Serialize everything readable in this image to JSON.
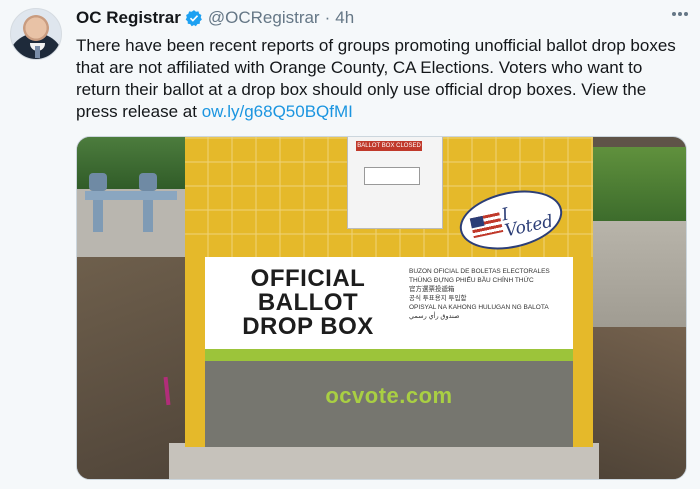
{
  "tweet": {
    "author_name": "OC Registrar",
    "handle": "@OCRegistrar",
    "separator": "·",
    "time": "4h",
    "body_text": "There have been recent reports of groups promoting unofficial ballot drop boxes that are not affiliated with Orange County, CA Elections. Voters who want to return their ballot at a drop box should only use official drop boxes. View the press release at ",
    "link_text": "ow.ly/g68Q50BQfMI"
  },
  "photo": {
    "box_heading_line1": "OFFICIAL",
    "box_heading_line2": "BALLOT",
    "box_heading_line3": "DROP BOX",
    "sticker_text_line1": "I",
    "sticker_text_line2": "Voted",
    "slot_label": "BALLOT BOX CLOSED",
    "languages": [
      "BUZON OFICIAL DE BOLETAS ELECTORALES",
      "THÙNG ĐỰNG PHIẾU BẦU CHÍNH THỨC",
      "官方選票投遞箱",
      "공식 투표용지 투입함",
      "OPISYAL NA KAHONG HULUGAN NG BALOTA",
      "صندوق رأي رسمي"
    ],
    "website": "ocvote.com"
  },
  "colors": {
    "link": "#1b95e0",
    "verified_badge": "#1da1f2",
    "muted": "#657786",
    "box_yellow": "#e5b92a",
    "box_green": "#9cc43a"
  }
}
